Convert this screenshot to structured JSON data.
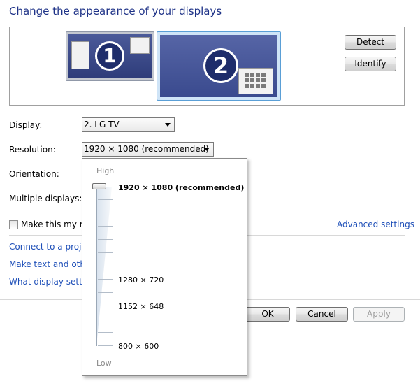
{
  "title": "Change the appearance of your displays",
  "monitors": [
    {
      "number": "1",
      "selected": false
    },
    {
      "number": "2",
      "selected": true
    }
  ],
  "buttons": {
    "detect": "Detect",
    "identify": "Identify",
    "ok": "OK",
    "cancel": "Cancel",
    "apply": "Apply"
  },
  "fields": {
    "display_label": "Display:",
    "display_value": "2. LG TV",
    "resolution_label": "Resolution:",
    "resolution_value": "1920 × 1080 (recommended)",
    "orientation_label": "Orientation:",
    "multiple_label": "Multiple displays:"
  },
  "checkbox": {
    "label": "Make this my ma",
    "checked": false
  },
  "links": {
    "advanced": "Advanced settings",
    "connect": "Connect to a projec",
    "make_text": "Make text and other",
    "what_display": "What display setting"
  },
  "resolution_popup": {
    "high_label": "High",
    "low_label": "Low",
    "options": [
      {
        "label": "1920 × 1080 (recommended)",
        "selected": true
      },
      {
        "label": "1280 × 720",
        "selected": false
      },
      {
        "label": "1152 × 648",
        "selected": false
      },
      {
        "label": "800 × 600",
        "selected": false
      }
    ],
    "slider_level": 1.0
  },
  "colors": {
    "title": "#1e3287",
    "link": "#1e4fb8",
    "monitor_selected_border": "#5a9fd6"
  }
}
